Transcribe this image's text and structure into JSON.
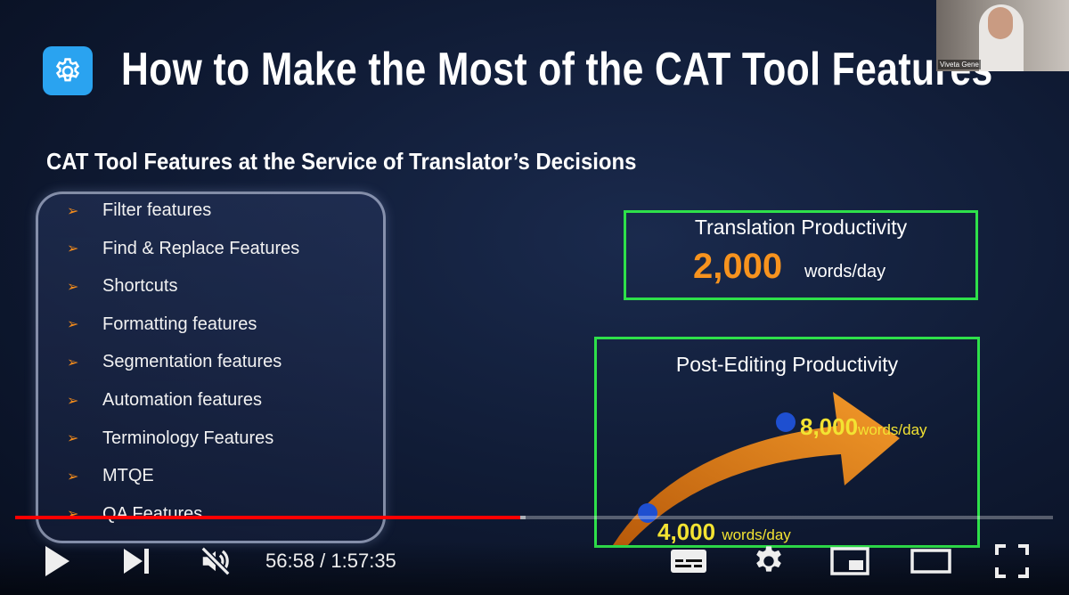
{
  "slide": {
    "title": "How to Make the Most of the CAT Tool Features",
    "subtitle": "CAT Tool Features at the Service of Translator’s Decisions",
    "features": [
      "Filter features",
      "Find & Replace Features",
      "Shortcuts",
      "Formatting features",
      "Segmentation features",
      "Automation features",
      "Terminology Features",
      "MTQE",
      "QA Features"
    ],
    "translation": {
      "title": "Translation Productivity",
      "value": "2,000",
      "unit": "words/day"
    },
    "post_editing": {
      "title": "Post-Editing Productivity",
      "high_value": "8,000",
      "high_unit": "words/day",
      "low_value": "4,000",
      "low_unit": "words/day"
    },
    "colors": {
      "accent_orange": "#f7931e",
      "box_green": "#2ee04a",
      "value_yellow": "#f3e332",
      "gear_blue": "#2aa3f0"
    }
  },
  "webcam": {
    "name": "Viveta Gene"
  },
  "player": {
    "current_time": "56:58",
    "duration": "1:57:35",
    "time_display": "56:58 / 1:57:35",
    "progress_fraction": 0.487,
    "buffered_fraction": 0.492,
    "muted": true
  }
}
